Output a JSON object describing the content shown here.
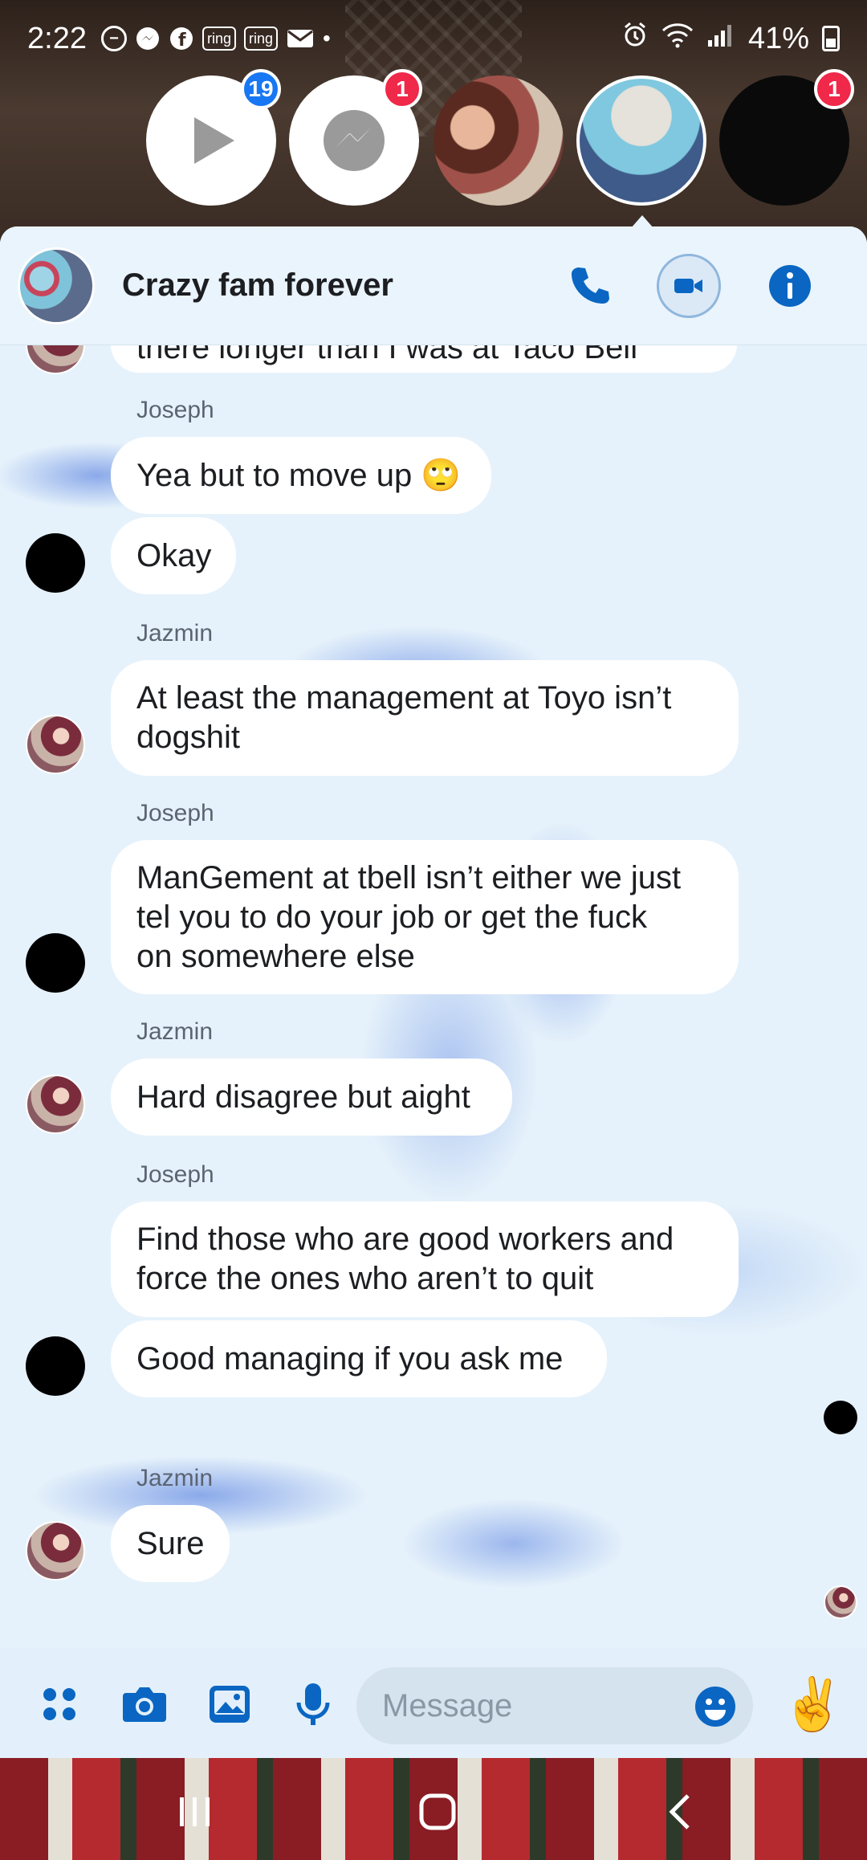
{
  "status_bar": {
    "time": "2:22",
    "battery": "41%",
    "notification_icons": [
      "dnd-icon",
      "messenger-icon",
      "facebook-icon",
      "ring-icon",
      "ring-icon",
      "mail-icon"
    ],
    "ring_label": "ring"
  },
  "chat_heads": [
    {
      "name": "video-app",
      "badge": "19"
    },
    {
      "name": "messenger",
      "badge": "1"
    },
    {
      "name": "person-collage",
      "badge": ""
    },
    {
      "name": "crazy-fam-group",
      "badge": ""
    },
    {
      "name": "dark-contact",
      "badge": "1"
    }
  ],
  "conversation": {
    "title": "Crazy fam forever",
    "partial_message": "there longer than I was at Taco Bell"
  },
  "messages": [
    {
      "sender": "Joseph",
      "lines": [
        "Yea but to move up 🙄"
      ]
    },
    {
      "sender": "",
      "lines": [
        "Okay"
      ]
    },
    {
      "sender": "Jazmin",
      "lines": [
        "At least the management at Toyo isn’t",
        "dogshit"
      ]
    },
    {
      "sender": "Joseph",
      "lines": [
        "ManGement at tbell isn’t either we just",
        "tel you to do your job or get the fuck",
        "on somewhere else"
      ]
    },
    {
      "sender": "Jazmin",
      "lines": [
        "Hard disagree but aight"
      ]
    },
    {
      "sender": "Joseph",
      "lines": [
        "Find those who are good workers and",
        "force the ones who aren’t to quit"
      ]
    },
    {
      "sender": "",
      "lines": [
        "Good managing if you ask me"
      ]
    },
    {
      "sender": "Jazmin",
      "lines": [
        "Sure"
      ]
    }
  ],
  "composer": {
    "placeholder": "Message",
    "emoji": "✌️"
  },
  "colors": {
    "accent": "#0a66c2",
    "badge_red": "#f02849",
    "badge_blue": "#1877f2"
  }
}
